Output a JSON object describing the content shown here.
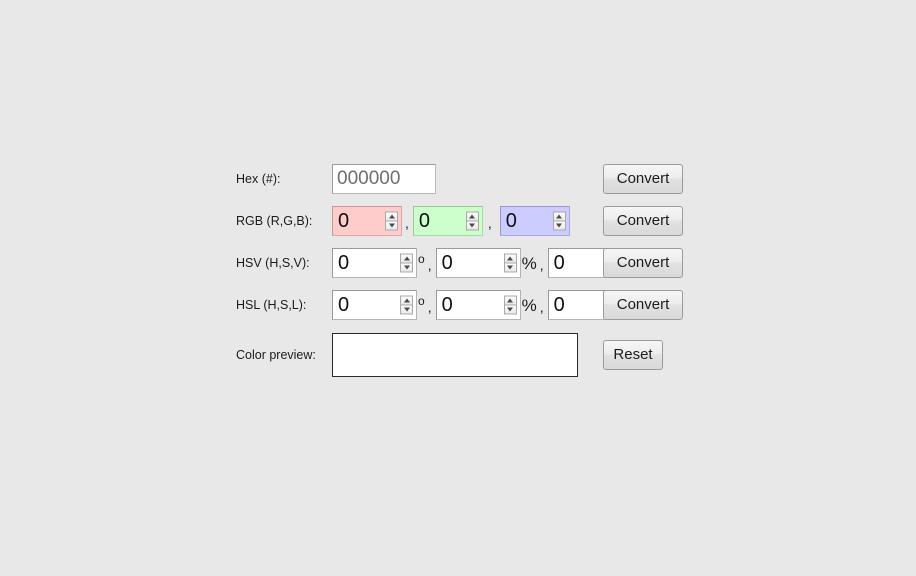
{
  "page": {
    "background_color": "#e8e8e8"
  },
  "form": {
    "rows": [
      {
        "id": "hex",
        "label": "Hex (#):",
        "value": "000000",
        "button": "Convert"
      },
      {
        "id": "rgb",
        "label": "RGB (R,G,B):",
        "button": "Convert",
        "separator": ",",
        "fields": [
          {
            "name": "red",
            "value": "0",
            "color": "#ffcccc"
          },
          {
            "name": "green",
            "value": "0",
            "color": "#ccffcc"
          },
          {
            "name": "blue",
            "value": "0",
            "color": "#ccccff"
          }
        ]
      },
      {
        "id": "hsv",
        "label": "HSV (H,S,V):",
        "button": "Convert",
        "separator": ",",
        "fields": [
          {
            "name": "hue",
            "value": "0",
            "unit": "o"
          },
          {
            "name": "saturation",
            "value": "0",
            "unit": "%"
          },
          {
            "name": "value",
            "value": "0",
            "unit": "%"
          }
        ]
      },
      {
        "id": "hsl",
        "label": "HSL (H,S,L):",
        "button": "Convert",
        "separator": ",",
        "fields": [
          {
            "name": "hue",
            "value": "0",
            "unit": "o"
          },
          {
            "name": "saturation",
            "value": "0",
            "unit": "%"
          },
          {
            "name": "lightness",
            "value": "0",
            "unit": "%"
          }
        ]
      }
    ],
    "preview": {
      "label": "Color preview:",
      "swatch_color": "#ffffff",
      "button": "Reset"
    }
  }
}
